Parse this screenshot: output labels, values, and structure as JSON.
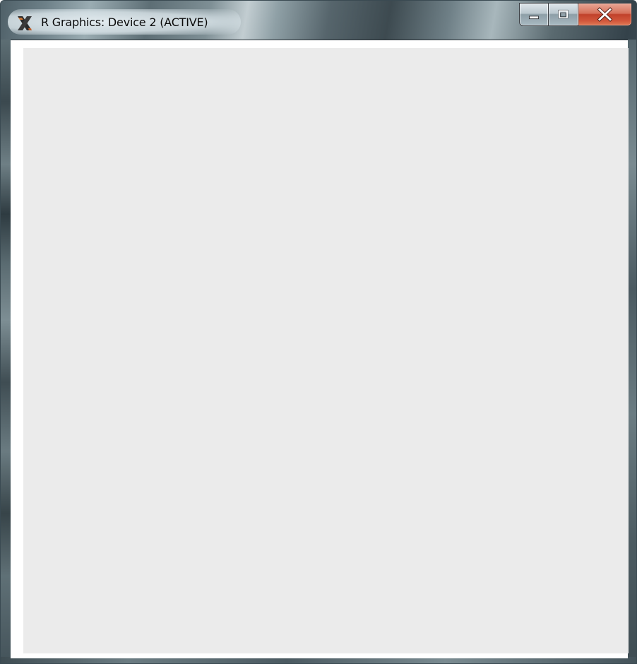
{
  "window": {
    "title": "R Graphics: Device 2 (ACTIVE)",
    "app_icon": "r-graphics-x-icon",
    "controls": {
      "minimize_icon": "minimize-icon",
      "maximize_icon": "maximize-icon",
      "close_icon": "close-icon"
    }
  },
  "plot": {
    "background_color": "#ebebeb",
    "content": "empty"
  },
  "colors": {
    "close_button": "#c0412a",
    "plot_panel": "#ebebeb",
    "client_background": "#ffffff"
  }
}
